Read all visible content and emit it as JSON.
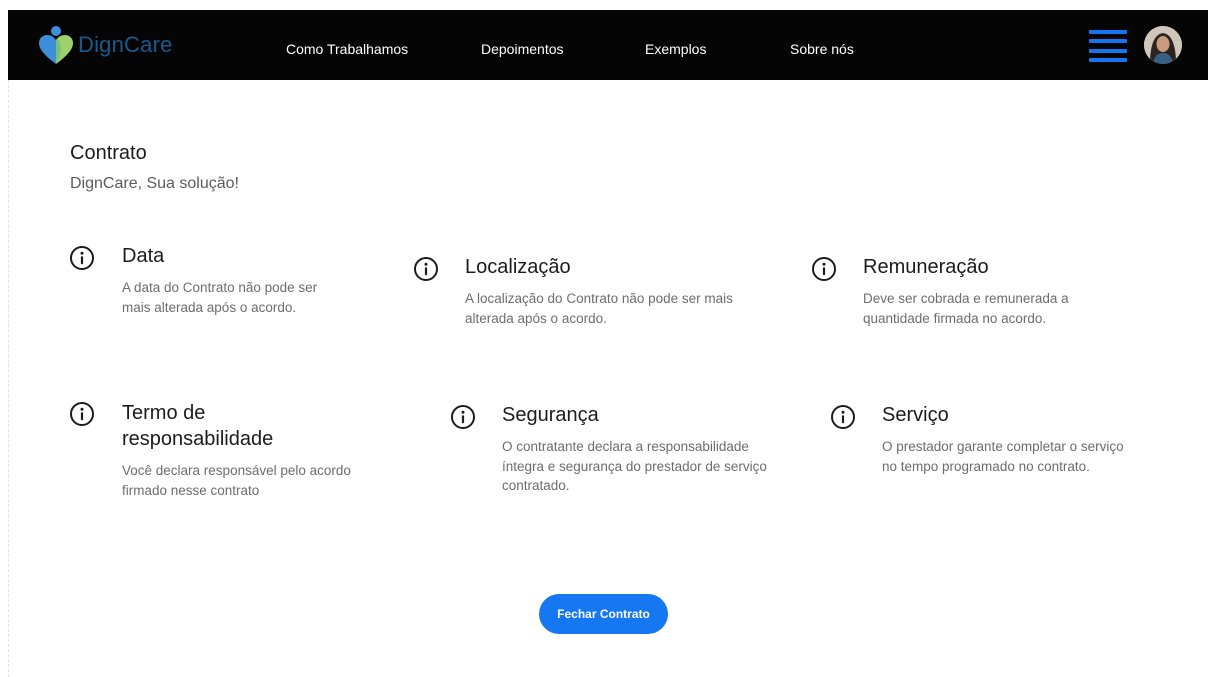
{
  "header": {
    "brand_name": "DignCare",
    "nav": [
      "Como Trabalhamos",
      "Depoimentos",
      "Exemplos",
      "Sobre nós"
    ]
  },
  "main": {
    "title": "Contrato",
    "subtitle": "DignCare, Sua solução!",
    "items": [
      {
        "title": "Data",
        "desc": "A data do Contrato não pode ser mais alterada após o acordo."
      },
      {
        "title": "Localização",
        "desc": "A localização do Contrato não pode ser mais alterada após o acordo."
      },
      {
        "title": "Remuneração",
        "desc": "Deve ser cobrada e remunerada a quantidade firmada no acordo."
      },
      {
        "title": "Termo de responsabilidade",
        "desc": "Você declara responsável pelo acordo firmado nesse contrato"
      },
      {
        "title": "Segurança",
        "desc": "O contratante declara a responsabilidade íntegra e segurança do prestador de serviço contratado."
      },
      {
        "title": "Serviço",
        "desc": "O prestador garante completar o serviço no tempo programado no contrato."
      }
    ],
    "button_label": "Fechar Contrato"
  },
  "icons": {
    "logo": "digncare-logo",
    "info": "info-circle-icon",
    "menu": "hamburger-menu-icon",
    "avatar": "user-avatar"
  },
  "colors": {
    "navbar_bg": "#050505",
    "accent": "#1677f2",
    "brand_logo_blue": "#3d8fd9",
    "brand_logo_green": "#9ed16b",
    "text_muted": "#6d6d6d"
  }
}
